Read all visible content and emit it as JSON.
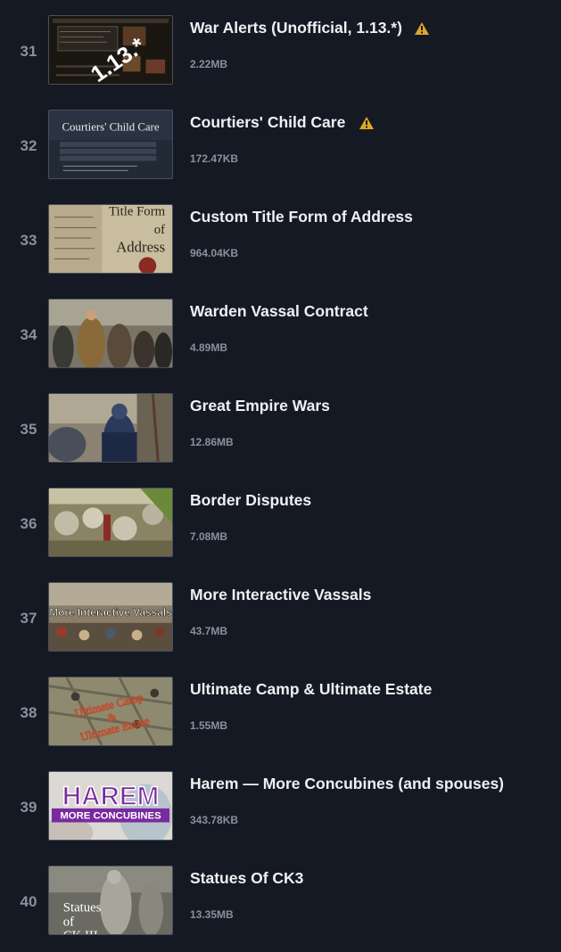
{
  "mods": [
    {
      "rank": "31",
      "title": "War Alerts (Unofficial, 1.13.*)",
      "size": "2.22MB",
      "warning": true,
      "thumb_text": "1.13.*",
      "thumb_icon": "war-alerts-thumbnail"
    },
    {
      "rank": "32",
      "title": "Courtiers' Child Care",
      "size": "172.47KB",
      "warning": true,
      "thumb_text": "Courtiers' Child Care",
      "thumb_icon": "child-care-thumbnail"
    },
    {
      "rank": "33",
      "title": "Custom Title Form of Address",
      "size": "964.04KB",
      "warning": false,
      "thumb_text": "Title Form of Address",
      "thumb_icon": "parchment-thumbnail"
    },
    {
      "rank": "34",
      "title": "Warden Vassal Contract",
      "size": "4.89MB",
      "warning": false,
      "thumb_icon": "painting-thumbnail"
    },
    {
      "rank": "35",
      "title": "Great Empire Wars",
      "size": "12.86MB",
      "warning": false,
      "thumb_icon": "knight-thumbnail"
    },
    {
      "rank": "36",
      "title": "Border Disputes",
      "size": "7.08MB",
      "warning": false,
      "thumb_icon": "battle-thumbnail"
    },
    {
      "rank": "37",
      "title": "More Interactive Vassals",
      "size": "43.7MB",
      "warning": false,
      "thumb_text": "More Interactive Vassals",
      "thumb_icon": "crowd-thumbnail"
    },
    {
      "rank": "38",
      "title": "Ultimate Camp & Ultimate Estate",
      "size": "1.55MB",
      "warning": false,
      "thumb_text": "Ultimate Camp & Ultimate Estate",
      "thumb_icon": "map-thumbnail"
    },
    {
      "rank": "39",
      "title": "Harem — More Concubines (and spouses)",
      "size": "343.78KB",
      "warning": false,
      "thumb_text": "HAREM",
      "thumb_subtext": "MORE CONCUBINES",
      "thumb_icon": "harem-thumbnail"
    },
    {
      "rank": "40",
      "title": "Statues Of CK3",
      "size": "13.35MB",
      "warning": false,
      "thumb_text": "Statues of CK III",
      "thumb_icon": "statue-thumbnail"
    }
  ],
  "colors": {
    "background": "#151923",
    "title": "#eef0f3",
    "muted": "#8a909c",
    "warning": "#e0a526"
  }
}
